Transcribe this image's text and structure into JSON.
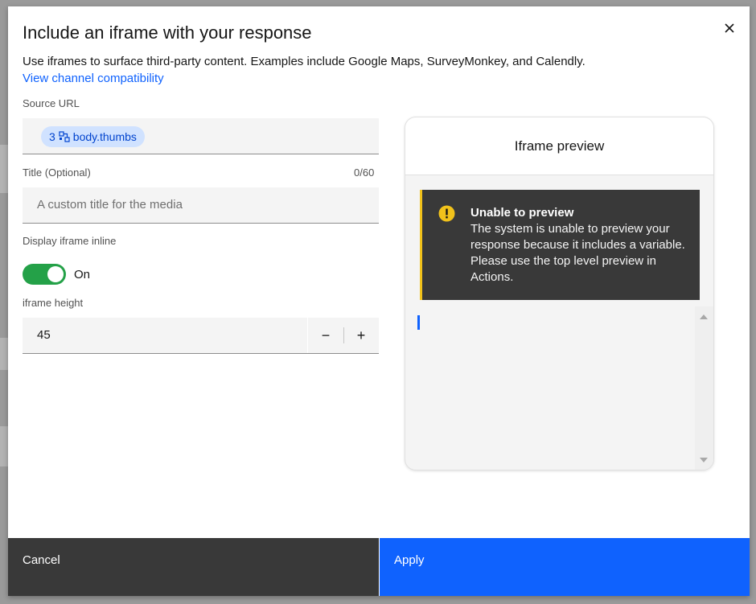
{
  "modal": {
    "title": "Include an iframe with your response",
    "description": "Use iframes to surface third-party content. Examples include Google Maps, SurveyMonkey, and Calendly.",
    "compat_link": "View channel compatibility",
    "close_icon": "close-icon"
  },
  "source_url": {
    "label": "Source URL",
    "chip_step": "3",
    "chip_icon": "variable-icon",
    "chip_text": "body.thumbs"
  },
  "title_field": {
    "label": "Title (Optional)",
    "counter": "0/60",
    "placeholder": "A custom title for the media"
  },
  "inline_toggle": {
    "label": "Display iframe inline",
    "state_text": "On",
    "on": true
  },
  "height_field": {
    "label": "iframe height",
    "value": "45",
    "decrement": "−",
    "increment": "+"
  },
  "preview": {
    "header": "Iframe preview",
    "notification_title": "Unable to preview",
    "notification_body": "The system is unable to preview your response because it includes a variable. Please use the top level preview in Actions.",
    "notification_icon": "warning-icon"
  },
  "footer": {
    "cancel": "Cancel",
    "apply": "Apply"
  },
  "colors": {
    "primary": "#0f62fe",
    "toggle_on": "#24a148",
    "warning": "#f1c21b",
    "dark": "#393939"
  }
}
